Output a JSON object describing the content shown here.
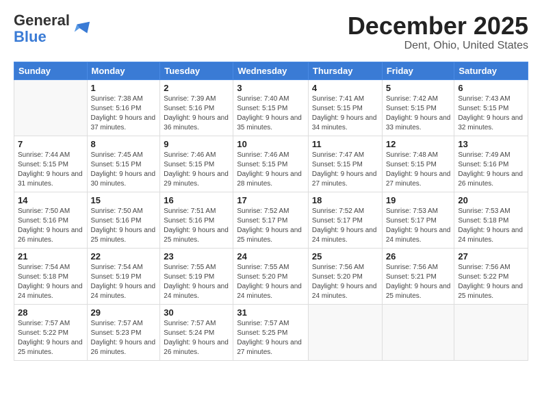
{
  "logo": {
    "general": "General",
    "blue": "Blue"
  },
  "header": {
    "month": "December 2025",
    "location": "Dent, Ohio, United States"
  },
  "weekdays": [
    "Sunday",
    "Monday",
    "Tuesday",
    "Wednesday",
    "Thursday",
    "Friday",
    "Saturday"
  ],
  "weeks": [
    [
      {
        "day": "",
        "empty": true
      },
      {
        "day": "1",
        "sunrise": "Sunrise: 7:38 AM",
        "sunset": "Sunset: 5:16 PM",
        "daylight": "Daylight: 9 hours and 37 minutes."
      },
      {
        "day": "2",
        "sunrise": "Sunrise: 7:39 AM",
        "sunset": "Sunset: 5:16 PM",
        "daylight": "Daylight: 9 hours and 36 minutes."
      },
      {
        "day": "3",
        "sunrise": "Sunrise: 7:40 AM",
        "sunset": "Sunset: 5:15 PM",
        "daylight": "Daylight: 9 hours and 35 minutes."
      },
      {
        "day": "4",
        "sunrise": "Sunrise: 7:41 AM",
        "sunset": "Sunset: 5:15 PM",
        "daylight": "Daylight: 9 hours and 34 minutes."
      },
      {
        "day": "5",
        "sunrise": "Sunrise: 7:42 AM",
        "sunset": "Sunset: 5:15 PM",
        "daylight": "Daylight: 9 hours and 33 minutes."
      },
      {
        "day": "6",
        "sunrise": "Sunrise: 7:43 AM",
        "sunset": "Sunset: 5:15 PM",
        "daylight": "Daylight: 9 hours and 32 minutes."
      }
    ],
    [
      {
        "day": "7",
        "sunrise": "Sunrise: 7:44 AM",
        "sunset": "Sunset: 5:15 PM",
        "daylight": "Daylight: 9 hours and 31 minutes."
      },
      {
        "day": "8",
        "sunrise": "Sunrise: 7:45 AM",
        "sunset": "Sunset: 5:15 PM",
        "daylight": "Daylight: 9 hours and 30 minutes."
      },
      {
        "day": "9",
        "sunrise": "Sunrise: 7:46 AM",
        "sunset": "Sunset: 5:15 PM",
        "daylight": "Daylight: 9 hours and 29 minutes."
      },
      {
        "day": "10",
        "sunrise": "Sunrise: 7:46 AM",
        "sunset": "Sunset: 5:15 PM",
        "daylight": "Daylight: 9 hours and 28 minutes."
      },
      {
        "day": "11",
        "sunrise": "Sunrise: 7:47 AM",
        "sunset": "Sunset: 5:15 PM",
        "daylight": "Daylight: 9 hours and 27 minutes."
      },
      {
        "day": "12",
        "sunrise": "Sunrise: 7:48 AM",
        "sunset": "Sunset: 5:15 PM",
        "daylight": "Daylight: 9 hours and 27 minutes."
      },
      {
        "day": "13",
        "sunrise": "Sunrise: 7:49 AM",
        "sunset": "Sunset: 5:16 PM",
        "daylight": "Daylight: 9 hours and 26 minutes."
      }
    ],
    [
      {
        "day": "14",
        "sunrise": "Sunrise: 7:50 AM",
        "sunset": "Sunset: 5:16 PM",
        "daylight": "Daylight: 9 hours and 26 minutes."
      },
      {
        "day": "15",
        "sunrise": "Sunrise: 7:50 AM",
        "sunset": "Sunset: 5:16 PM",
        "daylight": "Daylight: 9 hours and 25 minutes."
      },
      {
        "day": "16",
        "sunrise": "Sunrise: 7:51 AM",
        "sunset": "Sunset: 5:16 PM",
        "daylight": "Daylight: 9 hours and 25 minutes."
      },
      {
        "day": "17",
        "sunrise": "Sunrise: 7:52 AM",
        "sunset": "Sunset: 5:17 PM",
        "daylight": "Daylight: 9 hours and 25 minutes."
      },
      {
        "day": "18",
        "sunrise": "Sunrise: 7:52 AM",
        "sunset": "Sunset: 5:17 PM",
        "daylight": "Daylight: 9 hours and 24 minutes."
      },
      {
        "day": "19",
        "sunrise": "Sunrise: 7:53 AM",
        "sunset": "Sunset: 5:17 PM",
        "daylight": "Daylight: 9 hours and 24 minutes."
      },
      {
        "day": "20",
        "sunrise": "Sunrise: 7:53 AM",
        "sunset": "Sunset: 5:18 PM",
        "daylight": "Daylight: 9 hours and 24 minutes."
      }
    ],
    [
      {
        "day": "21",
        "sunrise": "Sunrise: 7:54 AM",
        "sunset": "Sunset: 5:18 PM",
        "daylight": "Daylight: 9 hours and 24 minutes."
      },
      {
        "day": "22",
        "sunrise": "Sunrise: 7:54 AM",
        "sunset": "Sunset: 5:19 PM",
        "daylight": "Daylight: 9 hours and 24 minutes."
      },
      {
        "day": "23",
        "sunrise": "Sunrise: 7:55 AM",
        "sunset": "Sunset: 5:19 PM",
        "daylight": "Daylight: 9 hours and 24 minutes."
      },
      {
        "day": "24",
        "sunrise": "Sunrise: 7:55 AM",
        "sunset": "Sunset: 5:20 PM",
        "daylight": "Daylight: 9 hours and 24 minutes."
      },
      {
        "day": "25",
        "sunrise": "Sunrise: 7:56 AM",
        "sunset": "Sunset: 5:20 PM",
        "daylight": "Daylight: 9 hours and 24 minutes."
      },
      {
        "day": "26",
        "sunrise": "Sunrise: 7:56 AM",
        "sunset": "Sunset: 5:21 PM",
        "daylight": "Daylight: 9 hours and 25 minutes."
      },
      {
        "day": "27",
        "sunrise": "Sunrise: 7:56 AM",
        "sunset": "Sunset: 5:22 PM",
        "daylight": "Daylight: 9 hours and 25 minutes."
      }
    ],
    [
      {
        "day": "28",
        "sunrise": "Sunrise: 7:57 AM",
        "sunset": "Sunset: 5:22 PM",
        "daylight": "Daylight: 9 hours and 25 minutes."
      },
      {
        "day": "29",
        "sunrise": "Sunrise: 7:57 AM",
        "sunset": "Sunset: 5:23 PM",
        "daylight": "Daylight: 9 hours and 26 minutes."
      },
      {
        "day": "30",
        "sunrise": "Sunrise: 7:57 AM",
        "sunset": "Sunset: 5:24 PM",
        "daylight": "Daylight: 9 hours and 26 minutes."
      },
      {
        "day": "31",
        "sunrise": "Sunrise: 7:57 AM",
        "sunset": "Sunset: 5:25 PM",
        "daylight": "Daylight: 9 hours and 27 minutes."
      },
      {
        "day": "",
        "empty": true
      },
      {
        "day": "",
        "empty": true
      },
      {
        "day": "",
        "empty": true
      }
    ]
  ]
}
